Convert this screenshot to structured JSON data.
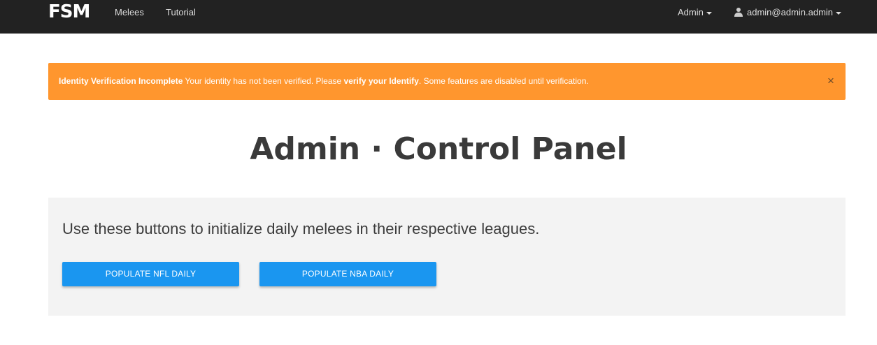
{
  "navbar": {
    "brand": "FSM",
    "links": [
      "Melees",
      "Tutorial"
    ],
    "admin_menu": "Admin",
    "user_menu": "admin@admin.admin"
  },
  "alert": {
    "title": "Identity Verification Incomplete",
    "message_before": " Your identity has not been verified. Please ",
    "link_text": "verify your Identify",
    "message_after": ". Some features are disabled until verification.",
    "close_symbol": "×",
    "color": "#ff962e"
  },
  "page": {
    "title": "Admin · Control Panel"
  },
  "well": {
    "text": "Use these buttons to initialize daily melees in their respective leagues.",
    "buttons": [
      "POPULATE NFL DAILY",
      "POPULATE NBA DAILY"
    ],
    "button_color": "#1a96f0"
  },
  "icons": {
    "user": "user-icon",
    "caret": "caret-down-icon",
    "close": "close-icon"
  }
}
